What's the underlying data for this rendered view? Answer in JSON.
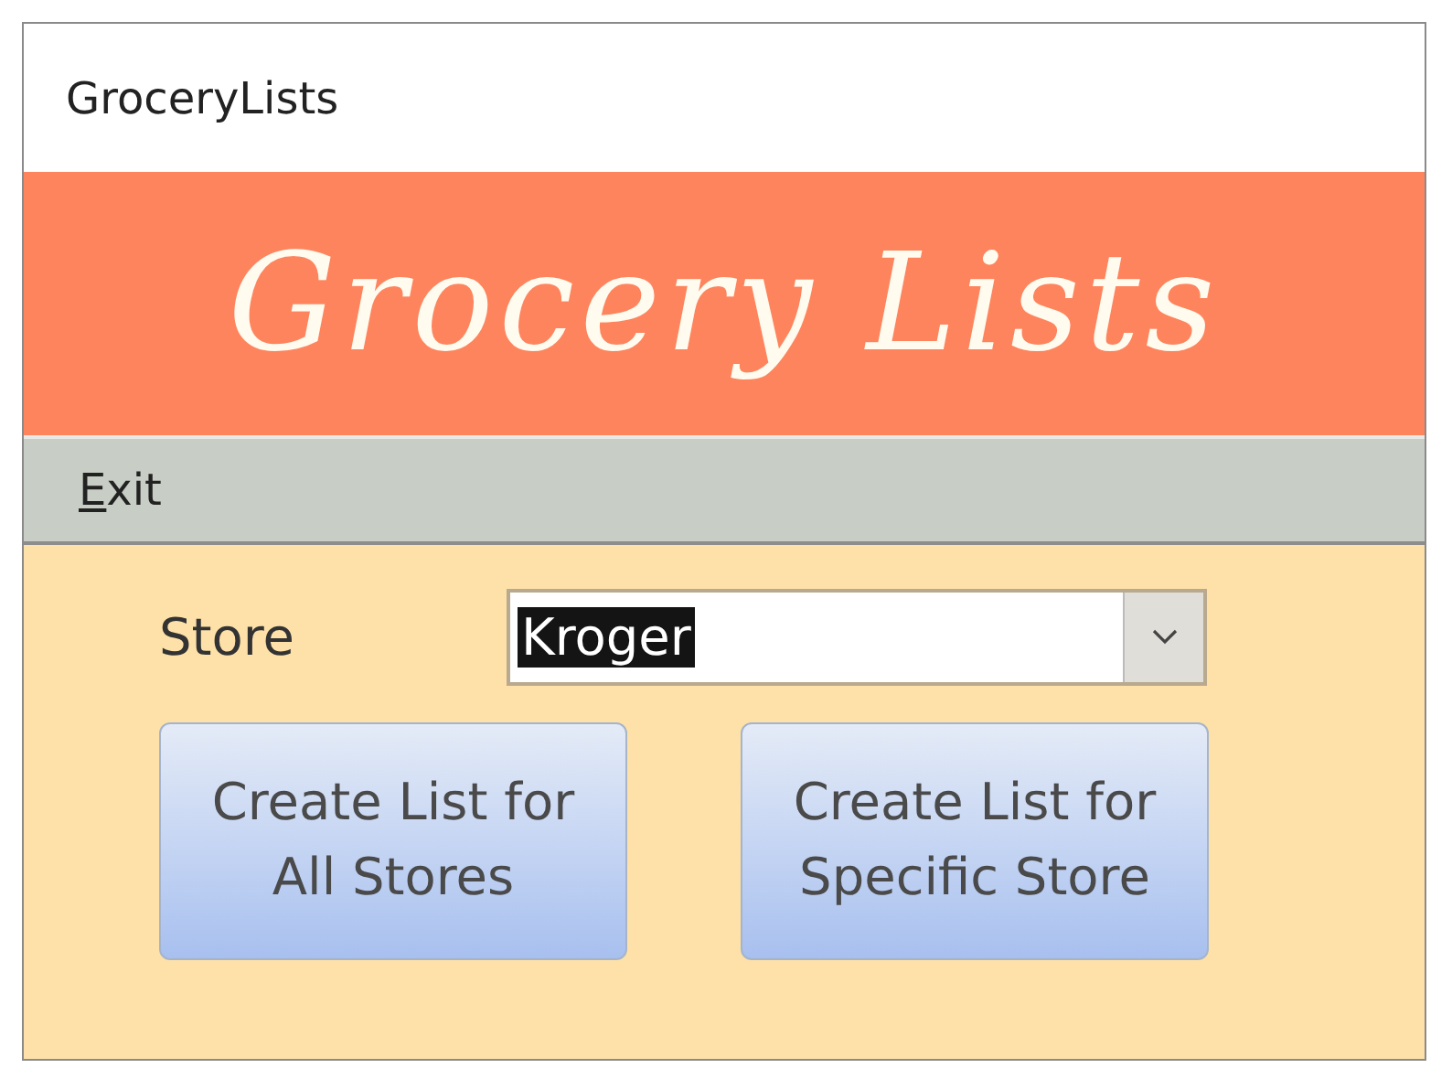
{
  "window": {
    "title": "GroceryLists"
  },
  "banner": {
    "title": "Grocery Lists"
  },
  "menu_bar": {
    "items": [
      {
        "access_key": "E",
        "label_rest": "xit"
      }
    ]
  },
  "form": {
    "store_label": "Store",
    "store_combo": {
      "value": "Kroger",
      "text_selected": true
    },
    "buttons": [
      {
        "label": "Create List for All Stores"
      },
      {
        "label": "Create List for Specific Store"
      }
    ]
  }
}
